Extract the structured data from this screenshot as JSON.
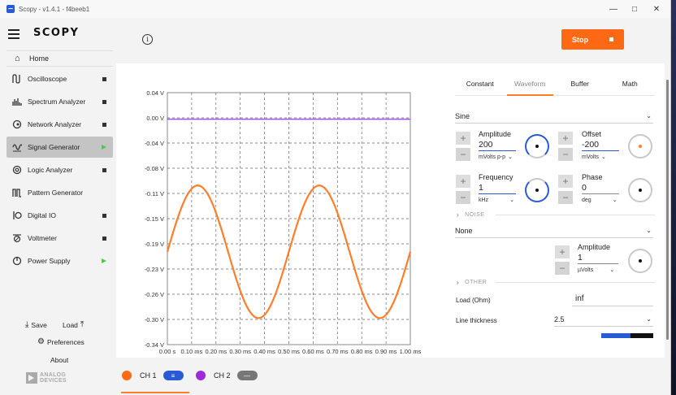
{
  "window": {
    "title": "Scopy - v1.4.1 - f4beeb1"
  },
  "sidebar": {
    "logo": "SCOPY",
    "home": "Home",
    "items": [
      {
        "label": "Oscilloscope",
        "icon": "oscilloscope-icon",
        "state": "stopped"
      },
      {
        "label": "Spectrum Analyzer",
        "icon": "spectrum-icon",
        "state": "stopped"
      },
      {
        "label": "Network Analyzer",
        "icon": "network-icon",
        "state": "stopped"
      },
      {
        "label": "Signal Generator",
        "icon": "siggen-icon",
        "state": "running"
      },
      {
        "label": "Logic Analyzer",
        "icon": "logic-icon",
        "state": "stopped"
      },
      {
        "label": "Pattern Generator",
        "icon": "pattern-icon",
        "state": "none"
      },
      {
        "label": "Digital IO",
        "icon": "dio-icon",
        "state": "stopped"
      },
      {
        "label": "Voltmeter",
        "icon": "voltmeter-icon",
        "state": "stopped"
      },
      {
        "label": "Power Supply",
        "icon": "power-icon",
        "state": "running"
      }
    ],
    "save": "Save",
    "load": "Load",
    "preferences": "Preferences",
    "about": "About",
    "brand_line1": "ANALOG",
    "brand_line2": "DEVICES"
  },
  "toolbar": {
    "stop_label": "Stop",
    "accent": "#ff6914"
  },
  "plot": {
    "y_ticks": [
      "0.04 V",
      "0.00 V",
      "-0.04 V",
      "-0.08 V",
      "-0.11 V",
      "-0.15 V",
      "-0.19 V",
      "-0.23 V",
      "-0.26 V",
      "-0.30 V",
      "-0.34 V"
    ],
    "x_ticks": [
      "0.00 s",
      "0.10 ms",
      "0.20 ms",
      "0.30 ms",
      "0.40 ms",
      "0.50 ms",
      "0.60 ms",
      "0.70 ms",
      "0.80 ms",
      "0.90 ms",
      "1.00 ms"
    ]
  },
  "chart_data": {
    "type": "line",
    "ylim": [
      -0.34,
      0.04
    ],
    "xlim": [
      0,
      1.0
    ],
    "grid": true,
    "series": [
      {
        "color": "#ff7e2a",
        "amplitude_v": 0.1,
        "offset_v": -0.2,
        "period_ms": 0.5,
        "phase_deg": 0
      },
      {
        "color": "#a04ef0",
        "constant_v": 0.0
      }
    ]
  },
  "channels": [
    {
      "label": "CH 1",
      "color": "#ff6914",
      "enabled": true
    },
    {
      "label": "CH 2",
      "color": "#9b2bd6",
      "enabled": false
    }
  ],
  "settings": {
    "tabs": [
      "Constant",
      "Waveform",
      "Buffer",
      "Math"
    ],
    "active_tab": "Waveform",
    "waveform_type": "Sine",
    "amplitude": {
      "label": "Amplitude",
      "value": "200",
      "unit": "mVolts p-p"
    },
    "offset": {
      "label": "Offset",
      "value": "-200",
      "unit": "mVolts"
    },
    "frequency": {
      "label": "Frequency",
      "value": "1",
      "unit": "kHz"
    },
    "phase": {
      "label": "Phase",
      "value": "0",
      "unit": "deg"
    },
    "noise_section": "NOISE",
    "noise_type": "None",
    "noise_amplitude": {
      "label": "Amplitude",
      "value": "1",
      "unit": "µVolts"
    },
    "other_section": "OTHER",
    "load_label": "Load (Ohm)",
    "load_value": "inf",
    "line_thickness_label": "Line thickness",
    "line_thickness_value": "2.5"
  }
}
